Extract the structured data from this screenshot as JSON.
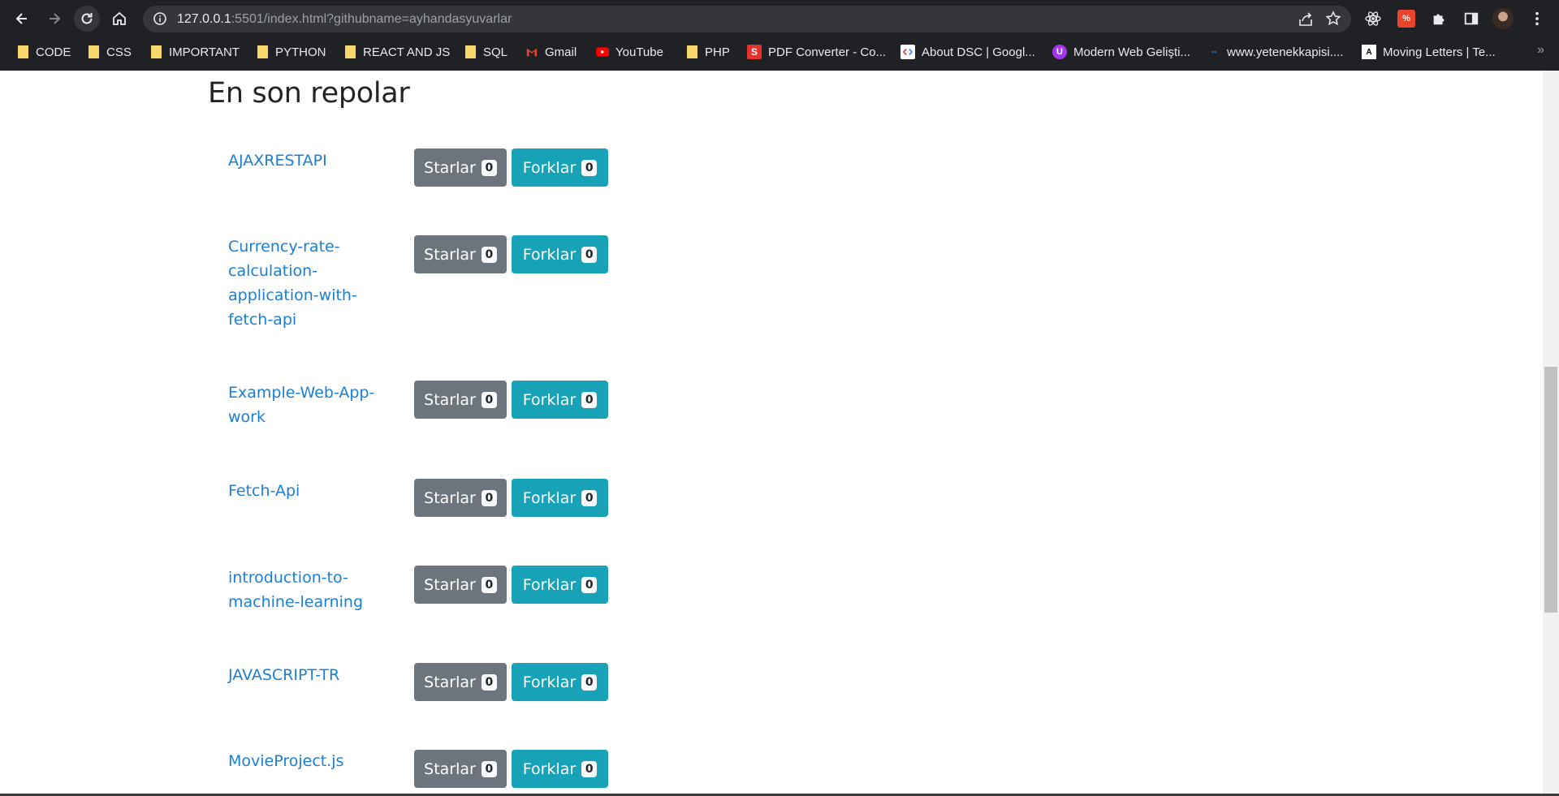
{
  "browser": {
    "url_host": "127.0.0.1",
    "url_rest": ":5501/index.html?githubname=ayhandasyuvarlar",
    "bookmarks": [
      {
        "label": "CODE",
        "icon": "folder-icon"
      },
      {
        "label": "CSS",
        "icon": "folder-icon"
      },
      {
        "label": "IMPORTANT",
        "icon": "folder-icon"
      },
      {
        "label": "PYTHON",
        "icon": "folder-icon"
      },
      {
        "label": "REACT AND JS",
        "icon": "folder-icon"
      },
      {
        "label": "SQL",
        "icon": "folder-icon"
      },
      {
        "label": "Gmail",
        "icon": "gmail-icon"
      },
      {
        "label": "YouTube",
        "icon": "youtube-icon"
      },
      {
        "label": "PHP",
        "icon": "folder-icon"
      },
      {
        "label": "PDF Converter - Co...",
        "icon": "pdf-converter-icon"
      },
      {
        "label": "About DSC | Googl...",
        "icon": "dsc-icon"
      },
      {
        "label": "Modern Web Gelişti...",
        "icon": "udemy-icon"
      },
      {
        "label": "www.yetenekkapisi....",
        "icon": "yetenekkapisi-icon"
      },
      {
        "label": "Moving Letters | Te...",
        "icon": "moving-letters-icon"
      }
    ],
    "more": "»"
  },
  "page": {
    "heading": "En son repolar",
    "stars_label": "Starlar",
    "forks_label": "Forklar",
    "repos": [
      {
        "name": "AJAXRESTAPI",
        "stars": "0",
        "forks": "0"
      },
      {
        "name": "Currency-rate-calculation-application-with-fetch-api",
        "stars": "0",
        "forks": "0"
      },
      {
        "name": "Example-Web-App-work",
        "stars": "0",
        "forks": "0"
      },
      {
        "name": "Fetch-Api",
        "stars": "0",
        "forks": "0"
      },
      {
        "name": "introduction-to-machine-learning",
        "stars": "0",
        "forks": "0"
      },
      {
        "name": "JAVASCRIPT-TR",
        "stars": "0",
        "forks": "0"
      },
      {
        "name": "MovieProject.js",
        "stars": "0",
        "forks": "0"
      }
    ]
  },
  "colors": {
    "link": "#1a7fd4",
    "btn_secondary": "#6c757d",
    "btn_info": "#17a2b8",
    "chrome_bg": "#202124"
  }
}
